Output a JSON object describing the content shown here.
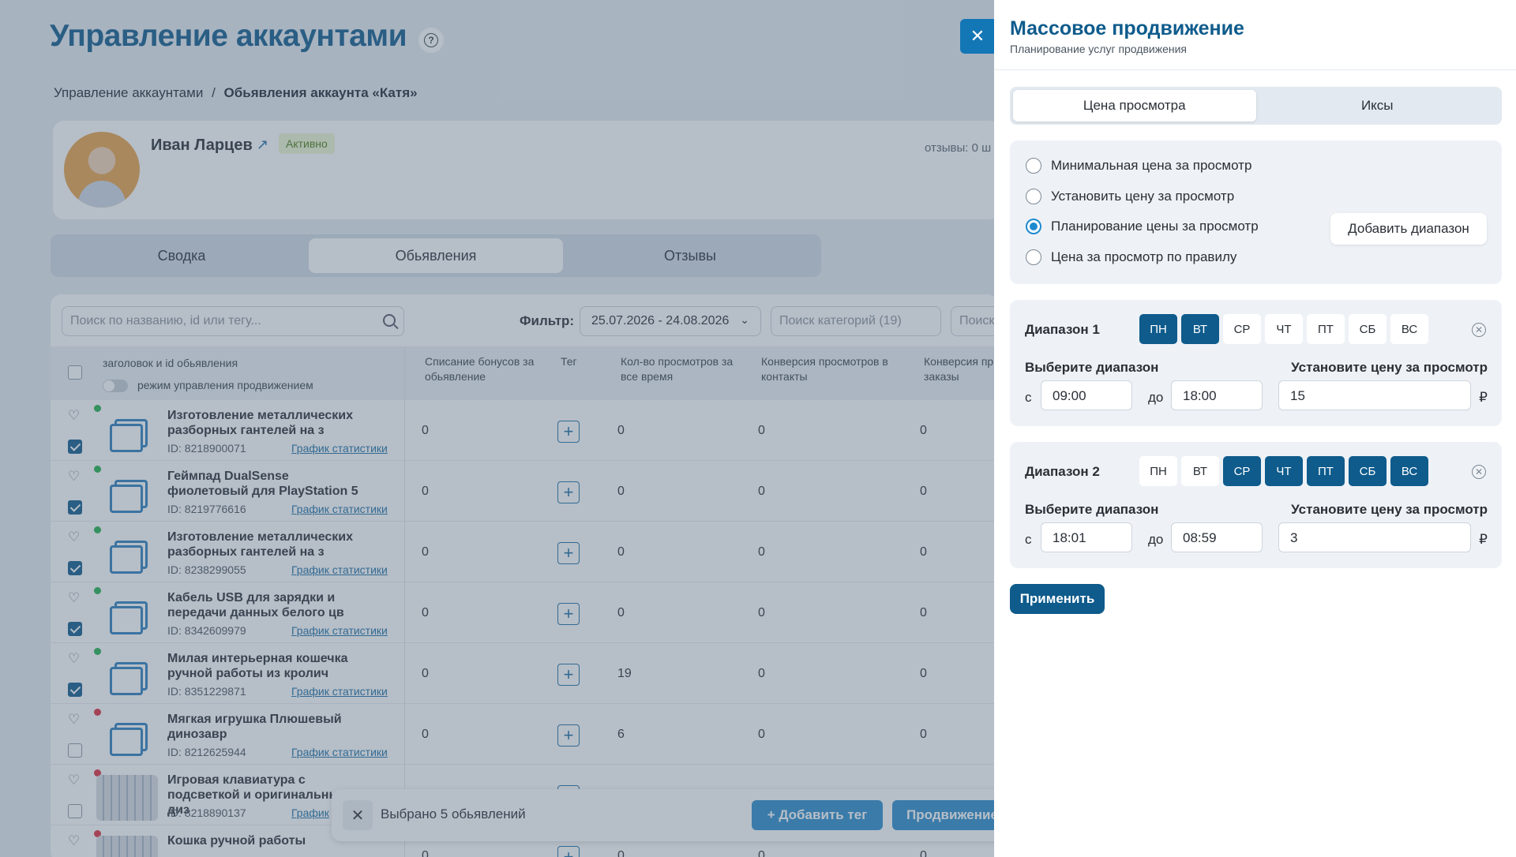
{
  "page": {
    "title": "Управление аккаунтами",
    "help_icon": "question-circle-icon",
    "breadcrumb": {
      "root": "Управление аккаунтами",
      "separator": "/",
      "current": "Обьявления аккаунта «Катя»"
    }
  },
  "profile": {
    "name": "Иван Ларцев",
    "status": "Активно",
    "reviews_text": "отзывы: 0 ш",
    "avatar_icon": "avatar-photo",
    "external_link_icon": "external-link-icon"
  },
  "tabs": [
    {
      "label": "Сводка",
      "active": false
    },
    {
      "label": "Обьявления",
      "active": true
    },
    {
      "label": "Отзывы",
      "active": false
    }
  ],
  "toolbar": {
    "search_placeholder": "Поиск по названию, id или тегу...",
    "filter_label": "Фильтр:",
    "date_range": "25.07.2026 - 24.08.2026",
    "category_placeholder": "Поиск категорий (19)",
    "search2_placeholder": "Поиск"
  },
  "table": {
    "headers": {
      "title_col": "заголовок и id обьявления",
      "mode_toggle": "режим управления продвижением",
      "bonus": "Списание бонусов за обьявление",
      "tag": "Тег",
      "views": "Кол-во просмотров за все время",
      "conv_contacts": "Конверсия просмотров в контакты",
      "conv_orders": "Конверсия пр в заказы"
    },
    "link_label": "График статистики",
    "link_label_short": "График",
    "rows": [
      {
        "title": "Изготовление металлических разборных гантелей на з",
        "id": "ID: 8218900071",
        "bonus": "0",
        "views": "0",
        "conv_contacts": "0",
        "conv_orders": "0",
        "checked": true,
        "status": "green",
        "thumb": "placeholder"
      },
      {
        "title": "Геймпад DualSense фиолетовый для PlayStation 5",
        "id": "ID: 8219776616",
        "bonus": "0",
        "views": "0",
        "conv_contacts": "0",
        "conv_orders": "0",
        "checked": true,
        "status": "green",
        "thumb": "placeholder"
      },
      {
        "title": "Изготовление металлических разборных гантелей на з",
        "id": "ID: 8238299055",
        "bonus": "0",
        "views": "0",
        "conv_contacts": "0",
        "conv_orders": "0",
        "checked": true,
        "status": "green",
        "thumb": "placeholder"
      },
      {
        "title": "Кабель USB для зарядки и передачи данных белого цв",
        "id": "ID: 8342609979",
        "bonus": "0",
        "views": "0",
        "conv_contacts": "0",
        "conv_orders": "0",
        "checked": true,
        "status": "green",
        "thumb": "placeholder"
      },
      {
        "title": "Милая интерьерная кошечка ручной работы из кролич",
        "id": "ID: 8351229871",
        "bonus": "0",
        "views": "19",
        "conv_contacts": "0",
        "conv_orders": "0",
        "checked": true,
        "status": "green",
        "thumb": "placeholder"
      },
      {
        "title": "Мягкая игрушка Плюшевый динозавр",
        "id": "ID: 8212625944",
        "bonus": "0",
        "views": "6",
        "conv_contacts": "0",
        "conv_orders": "0",
        "checked": false,
        "status": "red",
        "thumb": "placeholder"
      },
      {
        "title": "Игровая клавиатура с подсветкой и оригинальным диз",
        "id": "ID: 8218890137",
        "bonus": "0",
        "views": "0",
        "conv_contacts": "0",
        "conv_orders": "0",
        "checked": false,
        "status": "red",
        "thumb": "photo"
      },
      {
        "title": "Кошка ручной работы",
        "id": "",
        "bonus": "0",
        "views": "0",
        "conv_contacts": "0",
        "conv_orders": "0",
        "checked": false,
        "status": "red",
        "thumb": "photo"
      }
    ]
  },
  "selection_bar": {
    "text": "Выбрано 5 обьявлений",
    "add_tag": "+ Добавить тег",
    "promo": "Продвижение"
  },
  "panel": {
    "title": "Массовое продвижение",
    "subtitle": "Планирование услуг продвижения",
    "segments": [
      {
        "label": "Цена просмотра",
        "active": true
      },
      {
        "label": "Иксы",
        "active": false
      }
    ],
    "radios": [
      {
        "label": "Минимальная цена за просмотр",
        "selected": false
      },
      {
        "label": "Установить цену за просмотр",
        "selected": false
      },
      {
        "label": "Планирование цены за просмотр",
        "selected": true
      },
      {
        "label": "Цена за просмотр по правилу",
        "selected": false
      }
    ],
    "add_range": "Добавить диапазон",
    "ranges": [
      {
        "title": "Диапазон 1",
        "days": [
          {
            "label": "ПН",
            "on": true
          },
          {
            "label": "ВТ",
            "on": true
          },
          {
            "label": "СР",
            "on": false
          },
          {
            "label": "ЧТ",
            "on": false
          },
          {
            "label": "ПТ",
            "on": false
          },
          {
            "label": "СБ",
            "on": false
          },
          {
            "label": "ВС",
            "on": false
          }
        ],
        "range_label": "Выберите диапазон",
        "price_label": "Установите цену за просмотр",
        "from_label": "с",
        "from": "09:00",
        "to_label": "до",
        "to": "18:00",
        "price": "15",
        "currency": "₽"
      },
      {
        "title": "Диапазон 2",
        "days": [
          {
            "label": "ПН",
            "on": false
          },
          {
            "label": "ВТ",
            "on": false
          },
          {
            "label": "СР",
            "on": true
          },
          {
            "label": "ЧТ",
            "on": true
          },
          {
            "label": "ПТ",
            "on": true
          },
          {
            "label": "СБ",
            "on": true
          },
          {
            "label": "ВС",
            "on": true
          }
        ],
        "range_label": "Выберите диапазон",
        "price_label": "Установите цену за просмотр",
        "from_label": "с",
        "from": "18:01",
        "to_label": "до",
        "to": "08:59",
        "price": "3",
        "currency": "₽"
      }
    ],
    "apply": "Применить"
  },
  "colors": {
    "brand": "#0e5b8c",
    "accent": "#2b8ccc",
    "status_green": "#22b14c",
    "status_red": "#e02b3c"
  }
}
